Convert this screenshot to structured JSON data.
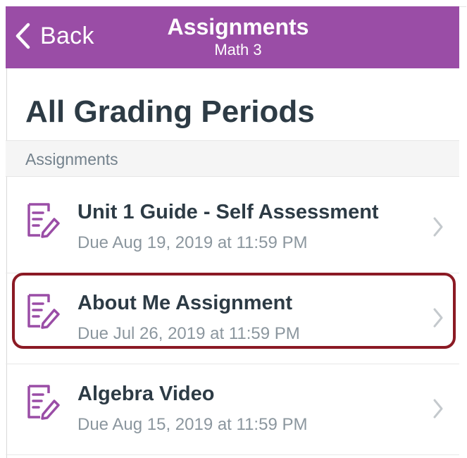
{
  "navbar": {
    "back_label": "Back",
    "title": "Assignments",
    "subtitle": "Math 3"
  },
  "page": {
    "title": "All Grading Periods"
  },
  "section": {
    "label": "Assignments"
  },
  "assignments": [
    {
      "title": "Unit 1 Guide - Self Assessment",
      "due": "Due Aug 19, 2019 at 11:59 PM"
    },
    {
      "title": "About Me Assignment",
      "due": "Due Jul 26, 2019 at 11:59 PM"
    },
    {
      "title": "Algebra Video",
      "due": "Due Aug 15, 2019 at 11:59 PM"
    }
  ],
  "icons": {
    "back": "chevron-left-icon",
    "assignment": "assignment-icon",
    "row_chevron": "chevron-right-icon"
  },
  "colors": {
    "navbar": "#9a4da6",
    "accent": "#9a4da6",
    "title_text": "#2d3b45",
    "muted_text": "#8b969e",
    "highlight": "#8b1a24"
  }
}
